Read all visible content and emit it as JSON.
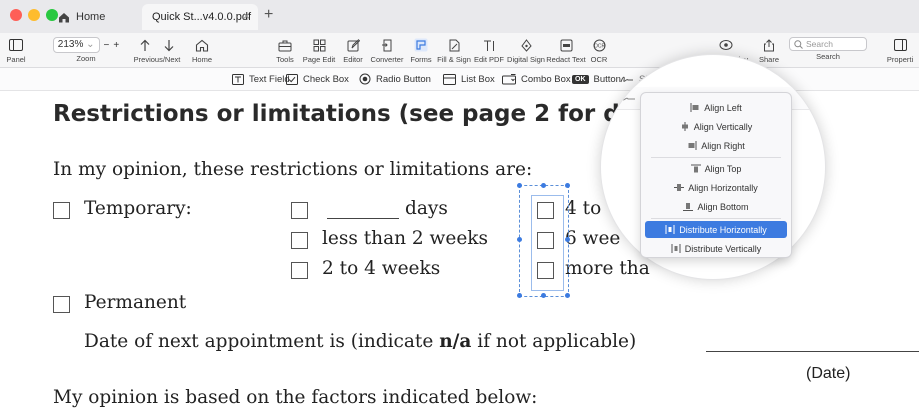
{
  "tabs": {
    "home_label": "Home",
    "active_label": "Quick St...v4.0.0.pdf",
    "close_glyph": "×",
    "add_glyph": "+"
  },
  "toolbar": {
    "panel": "Panel",
    "zoom_value": "213%",
    "zoom_out": "−",
    "zoom_in": "+",
    "zoom_label": "Zoom",
    "prevnext_label": "Previous/Next",
    "home_label": "Home",
    "tools": "Tools",
    "page_edit": "Page Edit",
    "editor": "Editor",
    "converter": "Converter",
    "forms": "Forms",
    "fill_sign": "Fill & Sign",
    "edit_pdf": "Edit PDF",
    "digital_sign": "Digital Sign",
    "redact_text": "Redact Text",
    "ocr": "OCR",
    "page_display": "Page Display",
    "share": "Share",
    "search_placeholder": "Search",
    "search_label": "Search",
    "properties": "Properti"
  },
  "forms_bar": {
    "text_field": "Text Field",
    "check_box": "Check Box",
    "radio_button": "Radio Button",
    "list_box": "List Box",
    "combo_box": "Combo Box",
    "ok_badge": "OK",
    "button": "Button",
    "signature_partial": "Si... ⌄"
  },
  "document": {
    "heading": "Restrictions or limitations (see page 2 for de",
    "opinion_line": "In my opinion, these restrictions or limitations are:",
    "temporary": "Temporary:",
    "days": "days",
    "less_than_2_weeks": "less than 2 weeks",
    "two_to_four_weeks": "2 to 4 weeks",
    "col3_row1": "4 to",
    "col3_row2": "6 wee",
    "col3_row3": "more tha",
    "permanent": "Permanent",
    "appointment_prefix": "Date of next appointment is (indicate ",
    "appointment_bold": "n/a",
    "appointment_suffix": " if not applicable)",
    "date_label": "(Date)",
    "factors_line": "My opinion is based on the factors indicated below:"
  },
  "align_menu": {
    "items": [
      {
        "label": "Align Left"
      },
      {
        "label": "Align Vertically"
      },
      {
        "label": "Align Right"
      },
      {
        "label": "Align Top"
      },
      {
        "label": "Align Horizontally"
      },
      {
        "label": "Align Bottom"
      },
      {
        "label": "Distribute Horizontally",
        "selected": true
      },
      {
        "label": "Distribute Vertically"
      }
    ]
  },
  "colors": {
    "accent": "#3d7be0",
    "traffic_red": "#fe5f57",
    "traffic_yellow": "#febc2e",
    "traffic_green": "#28c840"
  }
}
